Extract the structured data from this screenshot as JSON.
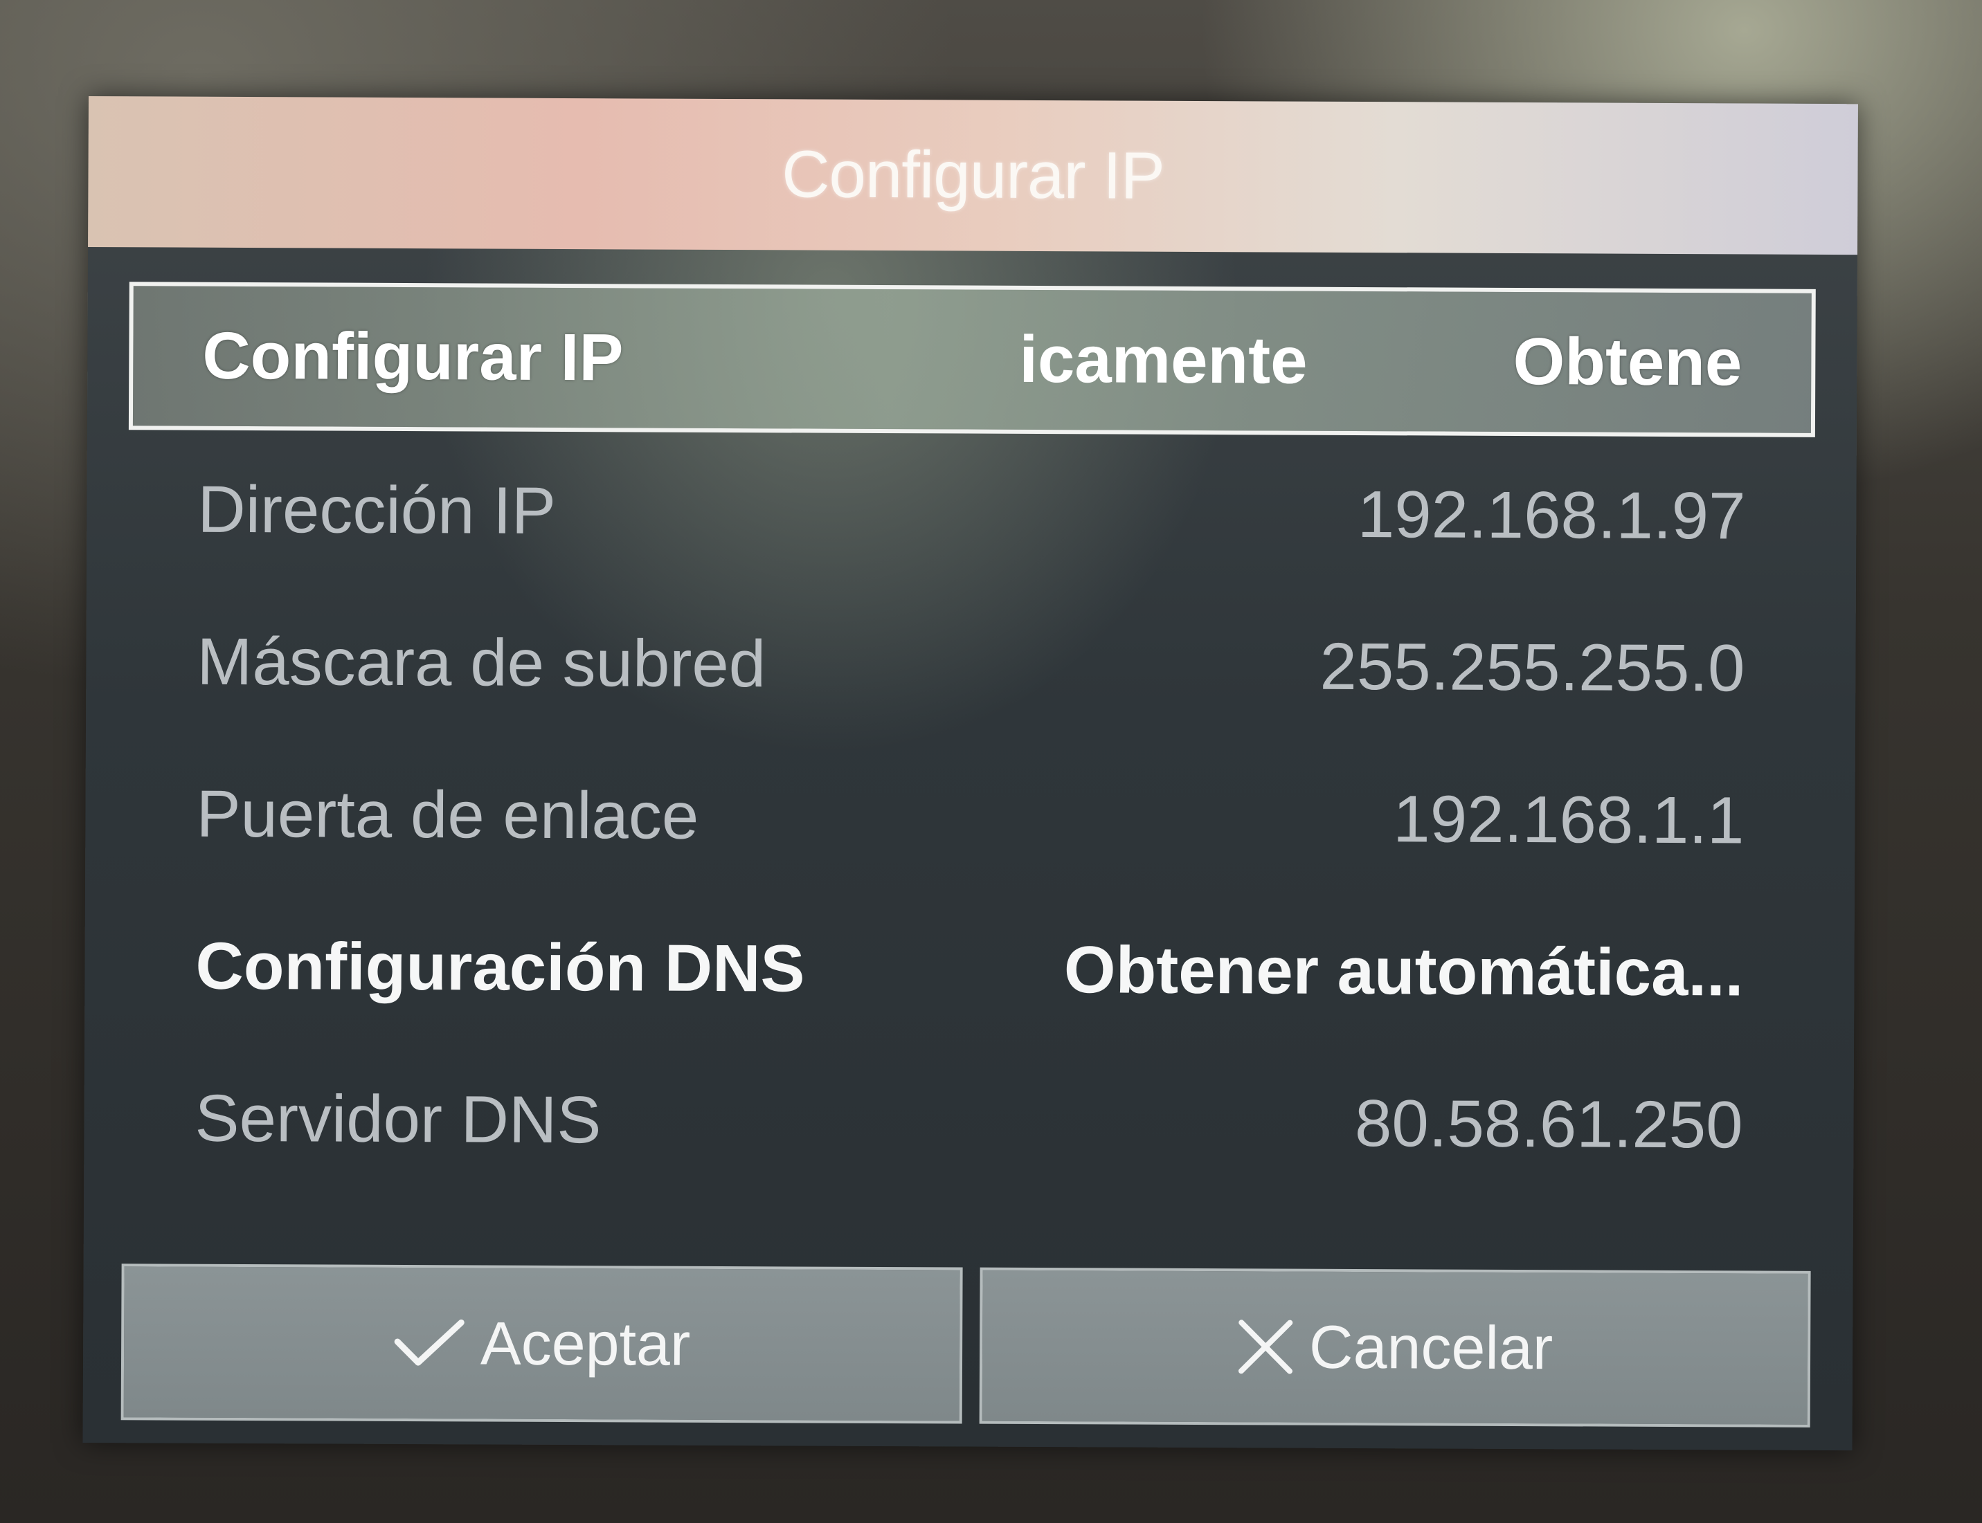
{
  "dialog": {
    "title": "Configurar IP"
  },
  "rows": {
    "ip_config": {
      "label": "Configurar IP",
      "value_partial_a": "icamente",
      "value_partial_b": "Obtene"
    },
    "ip_address": {
      "label": "Dirección IP",
      "value": "192.168.1.97"
    },
    "subnet_mask": {
      "label": "Máscara de subred",
      "value": "255.255.255.0"
    },
    "gateway": {
      "label": "Puerta de enlace",
      "value": "192.168.1.1"
    },
    "dns_config": {
      "label": "Configuración DNS",
      "value": "Obtener automática..."
    },
    "dns_server": {
      "label": "Servidor DNS",
      "value": "80.58.61.250"
    }
  },
  "buttons": {
    "accept": {
      "label": "Aceptar",
      "icon": "check-icon"
    },
    "cancel": {
      "label": "Cancelar",
      "icon": "close-icon"
    }
  }
}
